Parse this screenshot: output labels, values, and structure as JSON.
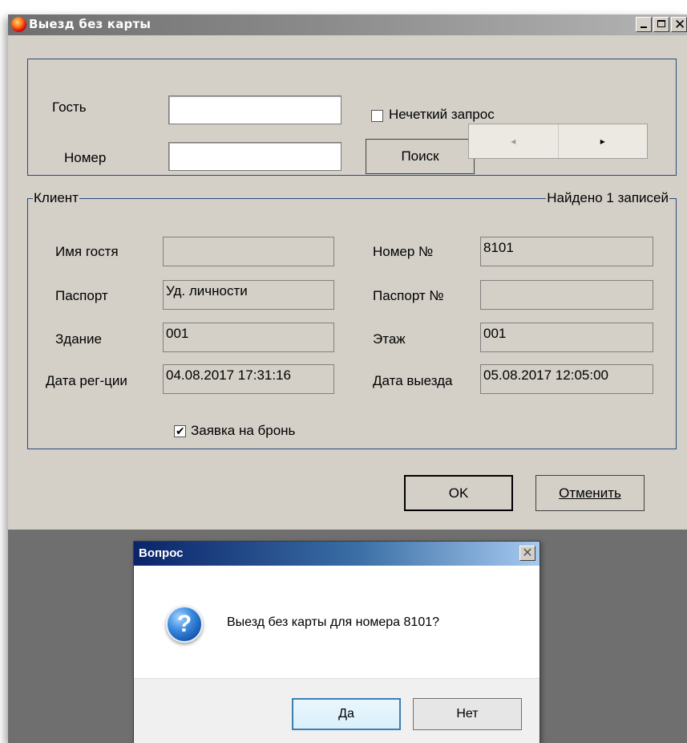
{
  "window": {
    "title": "Выезд без карты"
  },
  "search": {
    "guest_label": "Гость",
    "guest_value": "",
    "room_label": "Номер",
    "room_value": "",
    "fuzzy_label": "Нечеткий запрос",
    "fuzzy_checked": false,
    "search_button": "Поиск",
    "prev_arrow": "◂",
    "next_arrow": "▸"
  },
  "client": {
    "group_label": "Клиент",
    "found_text": "Найдено 1 записей",
    "guest_name_label": "Имя гостя",
    "guest_name_value": "",
    "room_no_label": "Номер №",
    "room_no_value": "8101",
    "passport_label": "Паспорт",
    "passport_value": "Уд. личности",
    "passport_no_label": "Паспорт №",
    "passport_no_value": "",
    "building_label": "Здание",
    "building_value": "001",
    "floor_label": "Этаж",
    "floor_value": "001",
    "reg_date_label": "Дата рег-ции",
    "reg_date_value": "04.08.2017 17:31:16",
    "checkout_date_label": "Дата выезда",
    "checkout_date_value": "05.08.2017 12:05:00",
    "booking_label": "Заявка на бронь",
    "booking_checked": true
  },
  "actions": {
    "ok": "OK",
    "cancel": "Отменить"
  },
  "dialog": {
    "title": "Вопрос",
    "message": "Выезд без карты для номера 8101?",
    "yes": "Да",
    "no": "Нет",
    "icon": "question-icon"
  }
}
